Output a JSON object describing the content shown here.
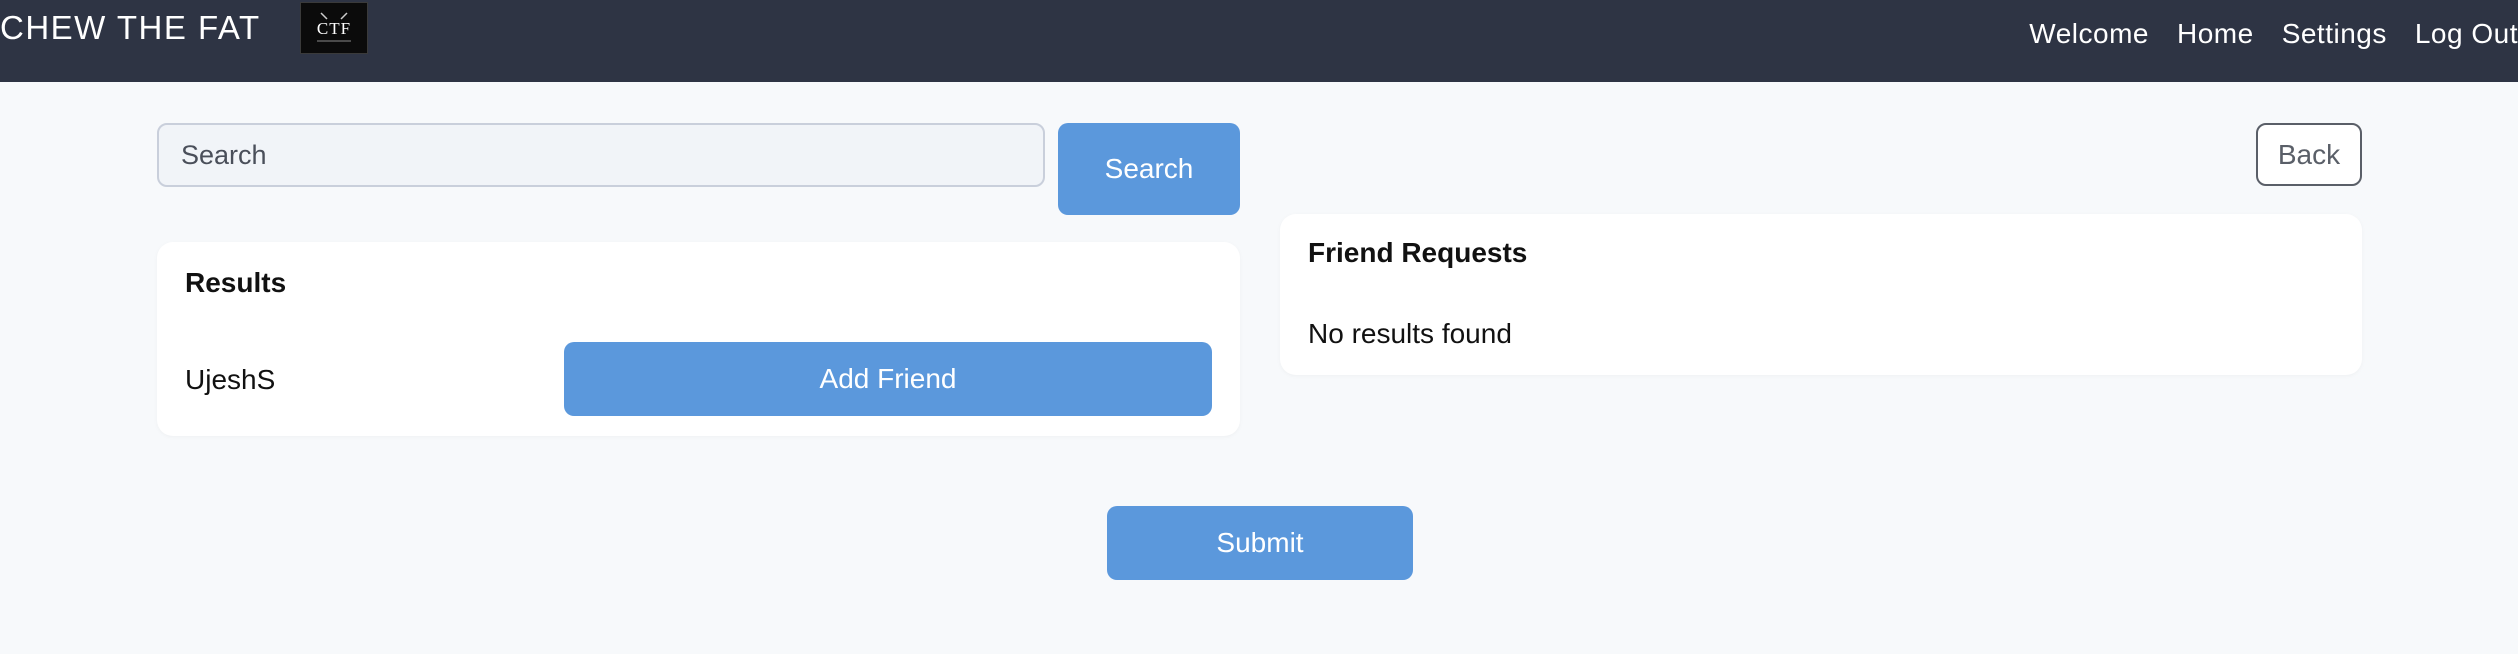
{
  "header": {
    "brand": "CHEW THE FAT",
    "logo_text": "CTF",
    "nav": [
      "Welcome",
      "Home",
      "Settings",
      "Log Out"
    ]
  },
  "search": {
    "placeholder": "Search",
    "value": "",
    "button_label": "Search"
  },
  "back_label": "Back",
  "results": {
    "title": "Results",
    "items": [
      {
        "name": "UjeshS",
        "action_label": "Add Friend"
      }
    ]
  },
  "friend_requests": {
    "title": "Friend Requests",
    "empty_text": "No results found"
  },
  "submit_label": "Submit",
  "colors": {
    "header_bg": "#2e3444",
    "accent": "#5b98dc",
    "page_bg": "#f7f9fb"
  }
}
